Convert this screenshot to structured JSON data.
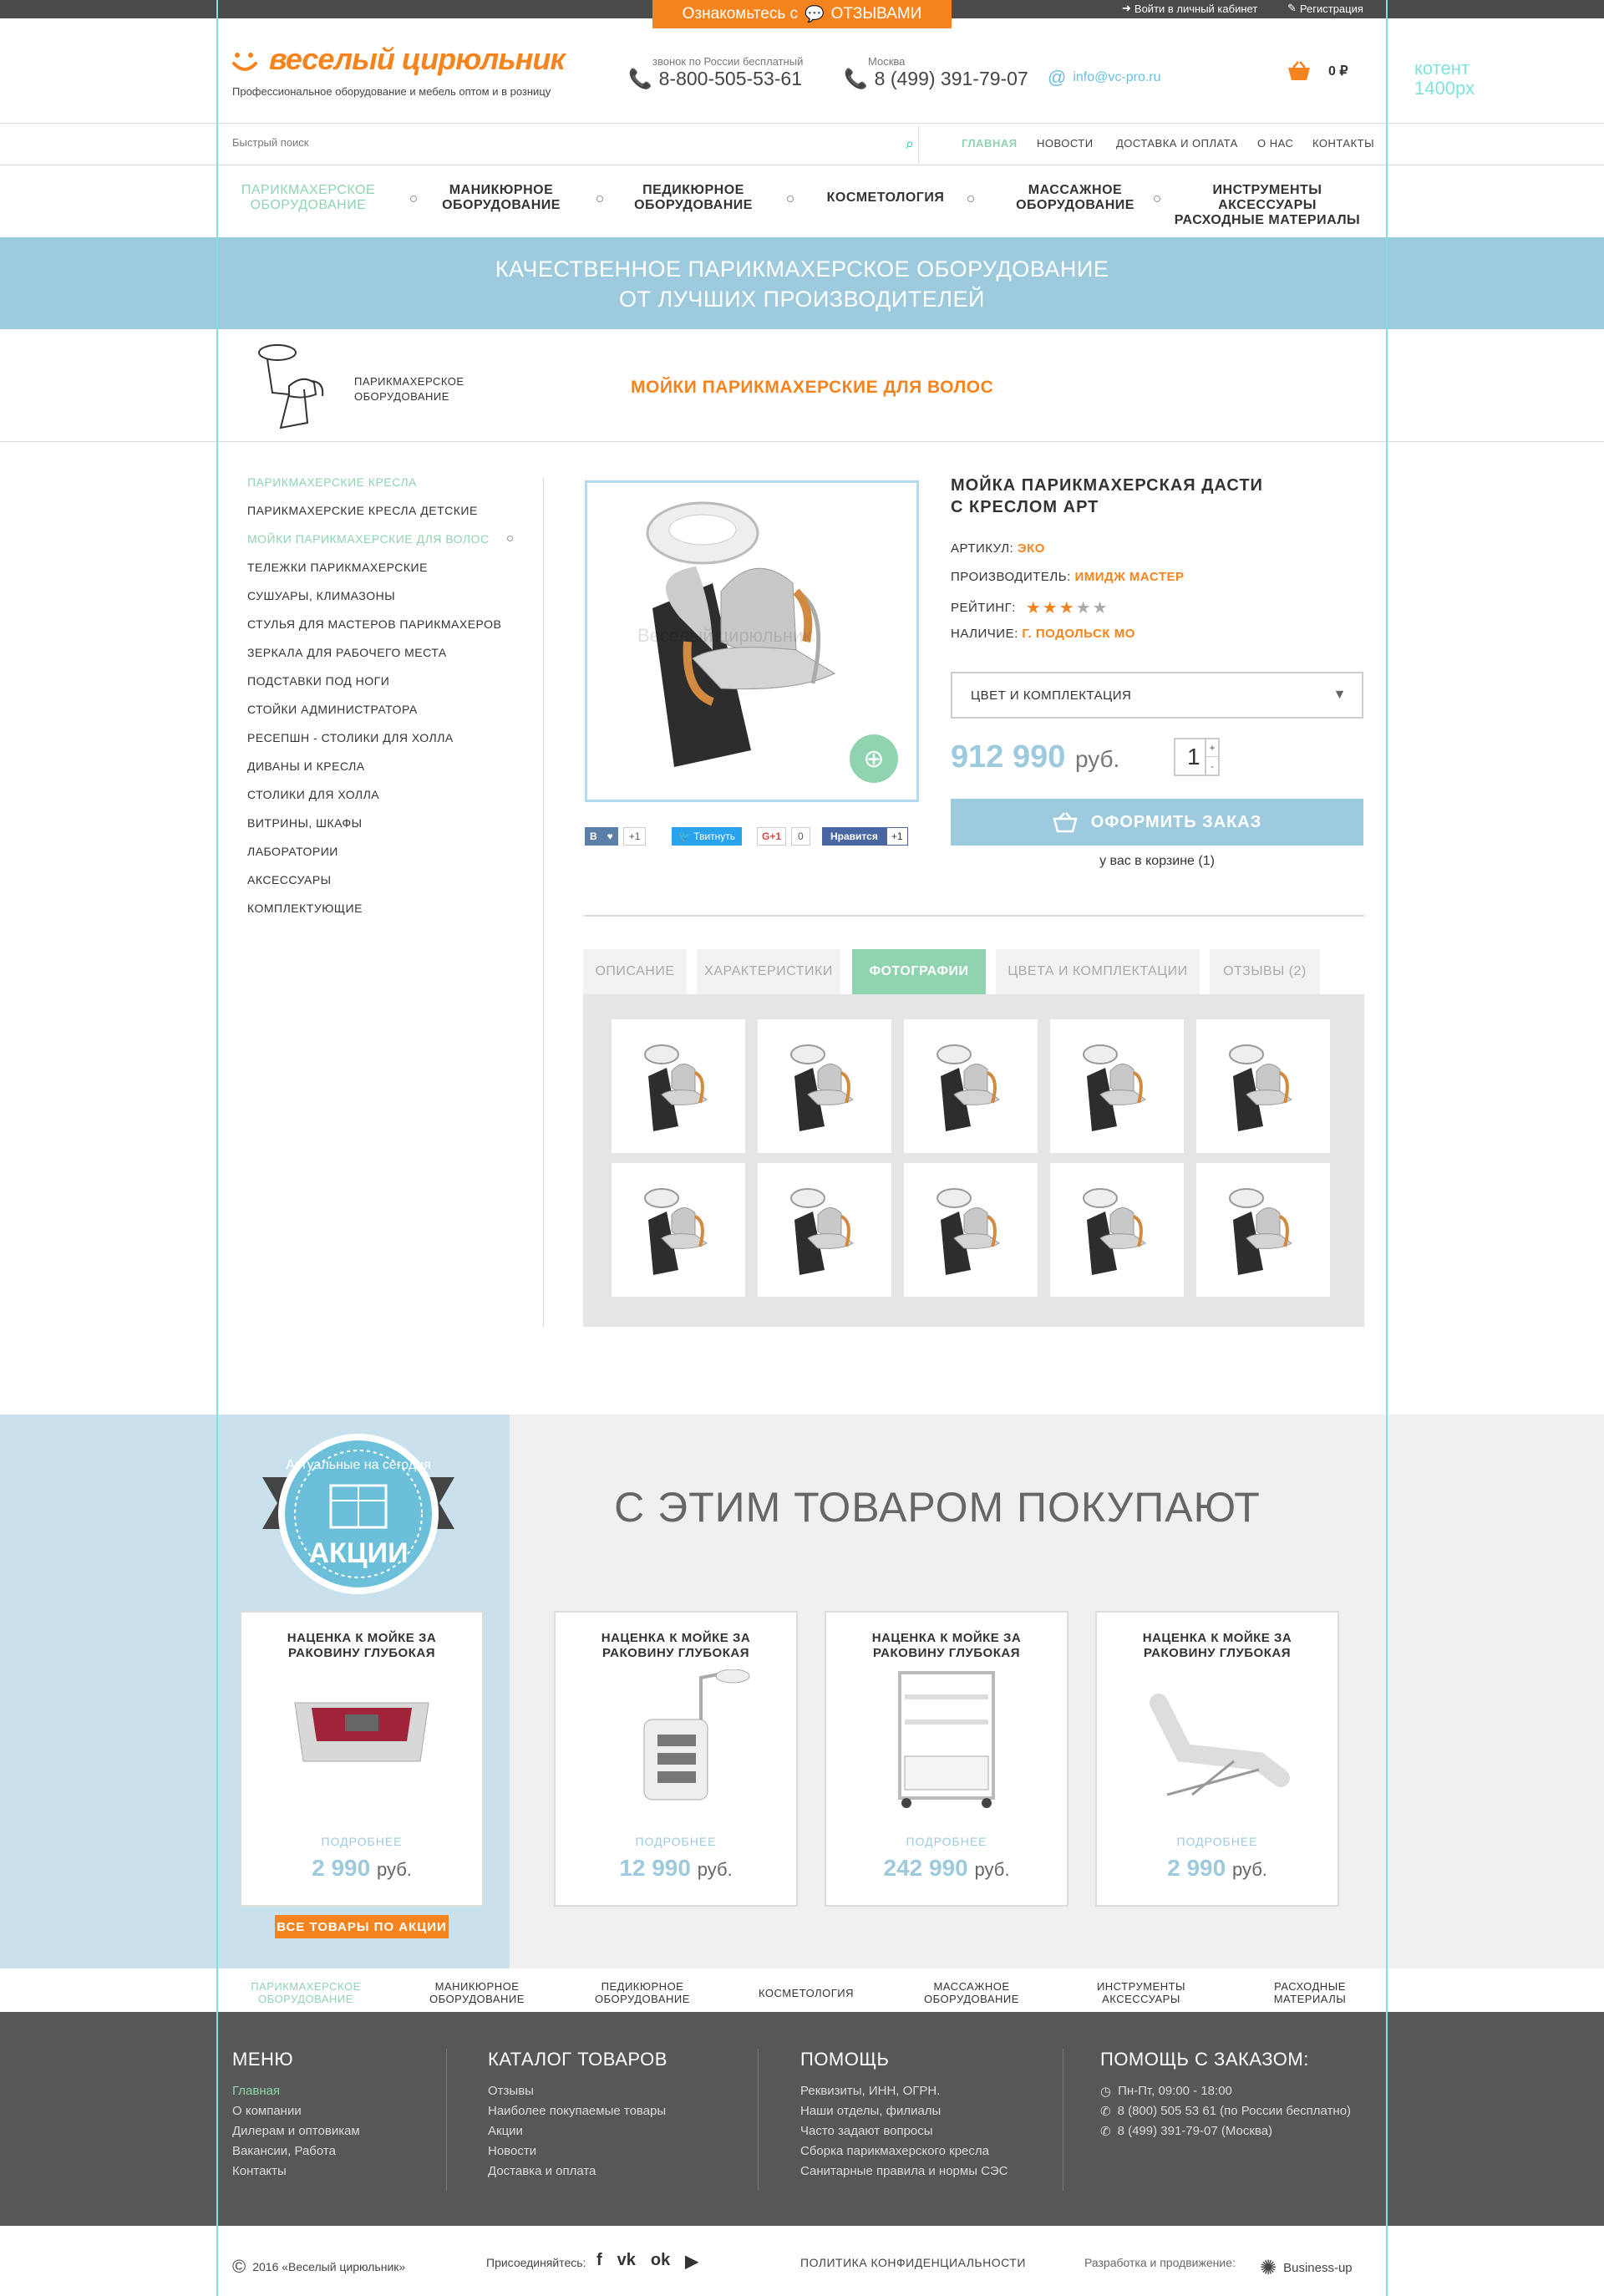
{
  "topbar": {
    "promo_prefix": "Ознакомьтесь с",
    "promo_suffix": "ОТЗЫВАМИ",
    "login": "Войти в личный кабинет",
    "register": "Регистрация"
  },
  "header": {
    "logo": "веселый цирюльник",
    "tagline": "Профессиональное оборудование и мебель оптом и в розницу",
    "phone1_caption": "звонок по России бесплатный",
    "phone1": "8-800-505-53-61",
    "phone2_caption": "Москва",
    "phone2": "8 (499) 391-79-07",
    "email": "info@vc-pro.ru",
    "cart_total": "0 ₽",
    "content_note_1": "котент",
    "content_note_2": "1400px"
  },
  "search": {
    "placeholder": "Быстрый поиск"
  },
  "topnav": [
    "ГЛАВНАЯ",
    "НОВОСТИ",
    "ДОСТАВКА И ОПЛАТА",
    "О НАС",
    "КОНТАКТЫ"
  ],
  "categories": [
    {
      "l1": "ПАРИКМАХЕРСКОЕ",
      "l2": "ОБОРУДОВАНИЕ"
    },
    {
      "l1": "МАНИКЮРНОЕ",
      "l2": "ОБОРУДОВАНИЕ"
    },
    {
      "l1": "ПЕДИКЮРНОЕ",
      "l2": "ОБОРУДОВАНИЕ"
    },
    {
      "l1": "КОСМЕТОЛОГИЯ",
      "l2": ""
    },
    {
      "l1": "МАССАЖНОЕ",
      "l2": "ОБОРУДОВАНИЕ"
    },
    {
      "l1": "ИНСТРУМЕНТЫ АКСЕССУАРЫ",
      "l2": "РАСХОДНЫЕ МАТЕРИАЛЫ"
    }
  ],
  "banner": {
    "line1": "КАЧЕСТВЕННОЕ ПАРИКМАХЕРСКОЕ ОБОРУДОВАНИЕ",
    "line2": "ОТ ЛУЧШИХ ПРОИЗВОДИТЕЛЕЙ"
  },
  "breadcrumb": {
    "l1": "ПАРИКМАХЕРСКОЕ",
    "l2": "ОБОРУДОВАНИЕ",
    "title": "МОЙКИ ПАРИКМАХЕРСКИЕ ДЛЯ ВОЛОС"
  },
  "sidebar": [
    "ПАРИКМАХЕРСКИЕ КРЕСЛА",
    "ПАРИКМАХЕРСКИЕ КРЕСЛА ДЕТСКИЕ",
    "МОЙКИ ПАРИКМАХЕРСКИЕ ДЛЯ ВОЛОС",
    "ТЕЛЕЖКИ ПАРИКМАХЕРСКИЕ",
    "СУШУАРЫ, КЛИМАЗОНЫ",
    "СТУЛЬЯ ДЛЯ МАСТЕРОВ ПАРИКМАХЕРОВ",
    "ЗЕРКАЛА ДЛЯ РАБОЧЕГО МЕСТА",
    "ПОДСТАВКИ ПОД НОГИ",
    "СТОЙКИ АДМИНИСТРАТОРА",
    "РЕСЕПШН - СТОЛИКИ ДЛЯ ХОЛЛА",
    "ДИВАНЫ И КРЕСЛА",
    "СТОЛИКИ ДЛЯ ХОЛЛА",
    "ВИТРИНЫ, ШКАФЫ",
    "ЛАБОРАТОРИИ",
    "АКСЕССУАРЫ",
    "КОМПЛЕКТУЮЩИЕ"
  ],
  "product": {
    "title_l1": "МОЙКА ПАРИКМАХЕРСКАЯ ДАСТИ",
    "title_l2": "С КРЕСЛОМ АРТ",
    "article_label": "АРТИКУЛ:",
    "article": "ЭКО",
    "maker_label": "ПРОИЗВОДИТЕЛЬ:",
    "maker": "ИМИДЖ МАСТЕР",
    "rating_label": "РЕЙТИНГ:",
    "rating": 3,
    "rating_max": 5,
    "stock_label": "НАЛИЧИЕ:",
    "stock": "Г. ПОДОЛЬСК МО",
    "select_label": "ЦВЕТ И КОМПЛЕКТАЦИЯ",
    "price": "912 990",
    "currency": "руб.",
    "qty": "1",
    "order_button": "ОФОРМИТЬ ЗАКАЗ",
    "in_cart": "у вас в корзине (1)",
    "watermark": "Веселый цирюльник"
  },
  "social": {
    "vk": "В",
    "vk_count": "+1",
    "tw": "Твитнуть",
    "gp": "G+1",
    "gp_count": "0",
    "fb": "Нравится",
    "fb_count": "+1"
  },
  "tabs": [
    "ОПИСАНИЕ",
    "ХАРАКТЕРИСТИКИ",
    "ФОТОГРАФИИ",
    "ЦВЕТА И КОМПЛЕКТАЦИИ",
    "ОТЗЫВЫ (2)"
  ],
  "related": {
    "title": "С ЭТИМ ТОВАРОМ ПОКУПАЮТ",
    "badge_top": "Актуальные на сегодня",
    "badge_main": "АКЦИИ",
    "all_button": "ВСЕ ТОВАРЫ ПО АКЦИИ",
    "cards": [
      {
        "t1": "НАЦЕНКА К МОЙКЕ ЗА",
        "t2": "РАКОВИНУ ГЛУБОКАЯ",
        "more": "ПОДРОБНЕЕ",
        "price": "2 990",
        "cur": "руб."
      },
      {
        "t1": "НАЦЕНКА К МОЙКЕ ЗА",
        "t2": "РАКОВИНУ ГЛУБОКАЯ",
        "more": "ПОДРОБНЕЕ",
        "price": "12 990",
        "cur": "руб."
      },
      {
        "t1": "НАЦЕНКА К МОЙКЕ ЗА",
        "t2": "РАКОВИНУ ГЛУБОКАЯ",
        "more": "ПОДРОБНЕЕ",
        "price": "242 990",
        "cur": "руб."
      },
      {
        "t1": "НАЦЕНКА К МОЙКЕ ЗА",
        "t2": "РАКОВИНУ ГЛУБОКАЯ",
        "more": "ПОДРОБНЕЕ",
        "price": "2 990",
        "cur": "руб."
      }
    ]
  },
  "bottom_categories": [
    {
      "l1": "ПАРИКМАХЕРСКОЕ",
      "l2": "ОБОРУДОВАНИЕ"
    },
    {
      "l1": "МАНИКЮРНОЕ",
      "l2": "ОБОРУДОВАНИЕ"
    },
    {
      "l1": "ПЕДИКЮРНОЕ",
      "l2": "ОБОРУДОВАНИЕ"
    },
    {
      "l1": "КОСМЕТОЛОГИЯ",
      "l2": ""
    },
    {
      "l1": "МАССАЖНОЕ",
      "l2": "ОБОРУДОВАНИЕ"
    },
    {
      "l1": "ИНСТРУМЕНТЫ",
      "l2": "АКСЕССУАРЫ"
    },
    {
      "l1": "РАСХОДНЫЕ",
      "l2": "МАТЕРИАЛЫ"
    }
  ],
  "footer": {
    "menu_title": "МЕНЮ",
    "menu": [
      "Главная",
      "О компании",
      "Дилерам и оптовикам",
      "Вакансии, Работа",
      "Контакты"
    ],
    "catalog_title": "КАТАЛОГ ТОВАРОВ",
    "catalog": [
      "Отзывы",
      "Наиболее покупаемые товары",
      "Акции",
      "Новости",
      "Доставка и оплата"
    ],
    "help_title": "ПОМОЩЬ",
    "help": [
      "Реквизиты, ИНН, ОГРН.",
      "Наши отделы, филиалы",
      "Часто задают вопросы",
      "Сборка парикмахерского кресла",
      "Санитарные правила и нормы СЭС"
    ],
    "order_title": "ПОМОЩЬ С ЗАКАЗОМ:",
    "order": [
      "Пн-Пт, 09:00 - 18:00",
      "8 (800) 505 53 61 (по России бесплатно)",
      "8 (499) 391-79-07 (Москва)"
    ]
  },
  "bottom": {
    "copyright": "2016 «Веселый цирюльник»",
    "join": "Присоединяйтесь:",
    "privacy": "ПОЛИТИКА КОНФИДЕНЦИАЛЬНОСТИ",
    "dev": "Разработка и продвижение:",
    "dev_brand": "Business-up"
  },
  "colors": {
    "accent": "#f5841f",
    "mint": "#8fd3b0",
    "sky": "#9ecadd",
    "guide": "#7fe3dc"
  }
}
